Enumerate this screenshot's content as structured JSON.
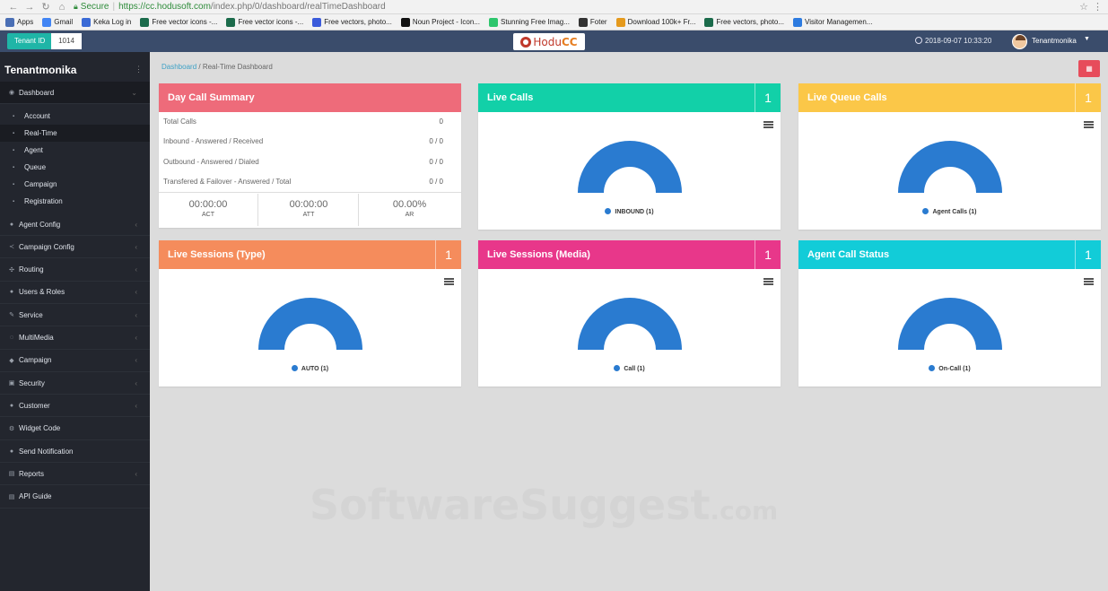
{
  "browser": {
    "secure_label": "Secure",
    "url_host": "https://cc.hodusoft.com",
    "url_path": "/index.php/0/dashboard/realTimeDashboard",
    "bookmarks": [
      {
        "label": "Apps",
        "icon": "apps-grid-icon",
        "color": "#4a6fb5"
      },
      {
        "label": "Gmail",
        "icon": "google-icon",
        "color": "#4285f4"
      },
      {
        "label": "Keka Log in",
        "icon": "keka-icon",
        "color": "#3a6ad6"
      },
      {
        "label": "Free vector icons -...",
        "icon": "freepik-icon",
        "color": "#1b6b4b"
      },
      {
        "label": "Free vector icons -...",
        "icon": "freepik-icon",
        "color": "#1b6b4b"
      },
      {
        "label": "Free vectors, photo...",
        "icon": "freepik-icon",
        "color": "#3b5bdb"
      },
      {
        "label": "Noun Project - Icon...",
        "icon": "noun-project-icon",
        "color": "#111111"
      },
      {
        "label": "Stunning Free Imag...",
        "icon": "pixabay-icon",
        "color": "#2ec66d"
      },
      {
        "label": "Foter",
        "icon": "foter-icon",
        "color": "#333333"
      },
      {
        "label": "Download 100k+ Fr...",
        "icon": "download-icon",
        "color": "#e59a1d"
      },
      {
        "label": "Free vectors, photo...",
        "icon": "freepik-icon",
        "color": "#1b6b4b"
      },
      {
        "label": "Visitor Managemen...",
        "icon": "visitor-icon",
        "color": "#2d7be0"
      }
    ]
  },
  "header": {
    "tenant_id_label": "Tenant ID",
    "tenant_id_value": "1014",
    "logo_text_main": "Hodu",
    "logo_text_accent": "CC",
    "datetime": "2018-09-07 10:33:20",
    "user_name": "Tenantmonika"
  },
  "sidebar": {
    "title": "Tenantmonika",
    "dashboard_label": "Dashboard",
    "sub_items": [
      {
        "label": "Account"
      },
      {
        "label": "Real-Time"
      },
      {
        "label": "Agent"
      },
      {
        "label": "Queue"
      },
      {
        "label": "Campaign"
      },
      {
        "label": "Registration"
      }
    ],
    "items": [
      {
        "label": "Agent Config",
        "icon": "user-icon",
        "caret": true
      },
      {
        "label": "Campaign Config",
        "icon": "share-icon",
        "caret": true
      },
      {
        "label": "Routing",
        "icon": "routing-icon",
        "caret": true
      },
      {
        "label": "Users & Roles",
        "icon": "users-icon",
        "caret": true
      },
      {
        "label": "Service",
        "icon": "wrench-icon",
        "caret": true
      },
      {
        "label": "MultiMedia",
        "icon": "media-icon",
        "caret": true
      },
      {
        "label": "Campaign",
        "icon": "campaign-icon",
        "caret": true
      },
      {
        "label": "Security",
        "icon": "lock-icon",
        "caret": true
      },
      {
        "label": "Customer",
        "icon": "customer-icon",
        "caret": true
      },
      {
        "label": "Widget Code",
        "icon": "gear-icon",
        "caret": false
      },
      {
        "label": "Send Notification",
        "icon": "bell-icon",
        "caret": false
      },
      {
        "label": "Reports",
        "icon": "file-icon",
        "caret": true
      },
      {
        "label": "API Guide",
        "icon": "api-icon",
        "caret": false
      }
    ]
  },
  "breadcrumb": {
    "link": "Dashboard",
    "separator": " / ",
    "current": "Real-Time Dashboard"
  },
  "day_summary": {
    "title": "Day Call Summary",
    "rows": [
      {
        "label": "Total Calls",
        "value": "0"
      },
      {
        "label": "Inbound - Answered / Received",
        "value": "0 / 0"
      },
      {
        "label": "Outbound - Answered / Dialed",
        "value": "0 / 0"
      },
      {
        "label": "Transfered & Failover - Answered / Total",
        "value": "0 / 0"
      }
    ],
    "stats": [
      {
        "value": "00:00:00",
        "label": "ACT"
      },
      {
        "value": "00:00:00",
        "label": "ATT"
      },
      {
        "value": "00.00%",
        "label": "AR"
      }
    ]
  },
  "cards": [
    {
      "key": "live-calls",
      "title": "Live Calls",
      "count": "1",
      "color": "#12d0a8",
      "legend": "INBOUND (1)"
    },
    {
      "key": "live-queue-calls",
      "title": "Live Queue Calls",
      "count": "1",
      "color": "#fbc748",
      "legend": "Agent Calls (1)"
    },
    {
      "key": "live-sessions-type",
      "title": "Live Sessions (Type)",
      "count": "1",
      "color": "#f58c5c",
      "legend": "AUTO (1)"
    },
    {
      "key": "live-sessions-media",
      "title": "Live Sessions (Media)",
      "count": "1",
      "color": "#e8378a",
      "legend": "Call (1)"
    },
    {
      "key": "agent-call-status",
      "title": "Agent Call Status",
      "count": "1",
      "color": "#12ccd8",
      "legend": "On-Call (1)"
    }
  ],
  "colors": {
    "day_summary_header": "#ee6b7a",
    "gauge_fill": "#2a7bd0",
    "sidebar_bg": "#23262e",
    "header_bg": "#3a4c6b"
  },
  "watermark": {
    "main": "SoftwareSuggest",
    "suffix": ".com"
  }
}
